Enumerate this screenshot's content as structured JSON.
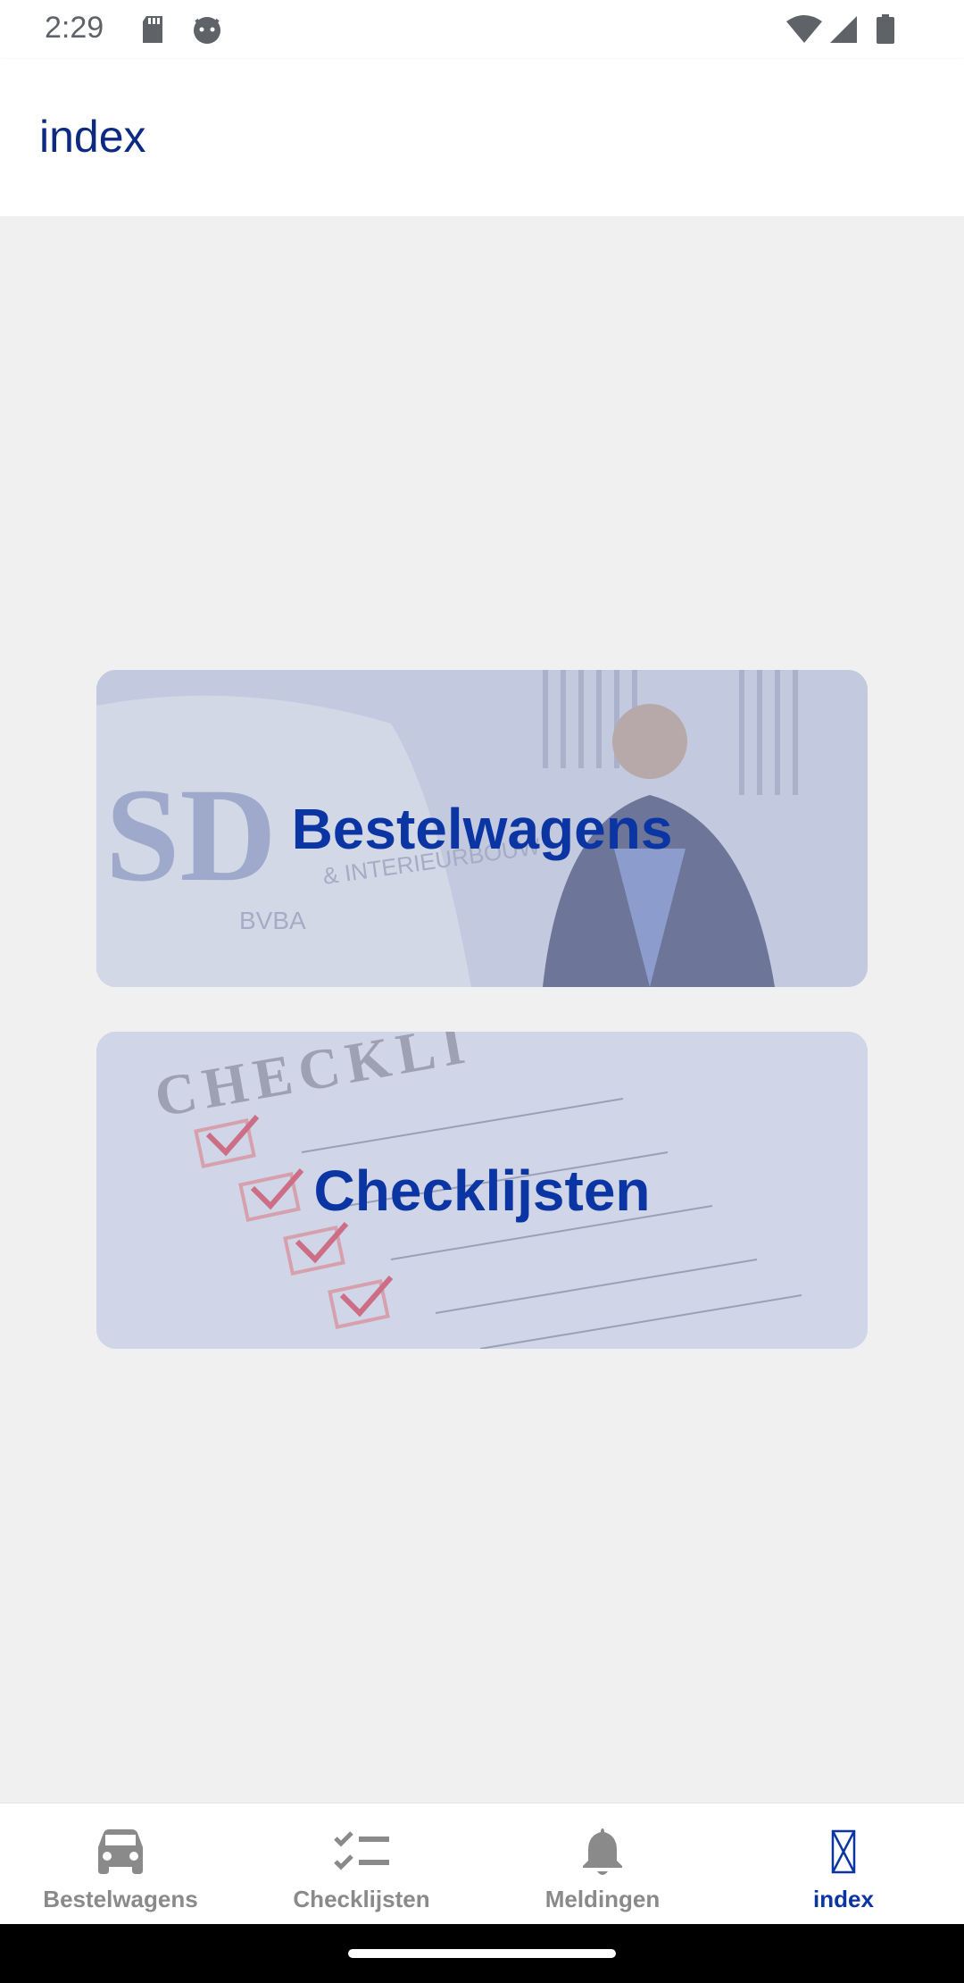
{
  "status_bar": {
    "time": "2:29",
    "icons": [
      "sd-card-icon",
      "cat-face-icon",
      "wifi-icon",
      "cell-signal-icon",
      "battery-icon"
    ]
  },
  "app_bar": {
    "title": "index"
  },
  "cards": {
    "bestelwagens": {
      "label": "Bestelwagens"
    },
    "checklijsten": {
      "label": "Checklijsten"
    }
  },
  "bottom_nav": {
    "items": [
      {
        "label": "Bestelwagens",
        "icon": "car-icon",
        "active": false
      },
      {
        "label": "Checklijsten",
        "icon": "checklist-icon",
        "active": false
      },
      {
        "label": "Meldingen",
        "icon": "bell-icon",
        "active": false
      },
      {
        "label": "index",
        "icon": "index-icon",
        "active": true
      }
    ]
  },
  "colors": {
    "accent": "#0a35a3",
    "title": "#0d2a82",
    "inactive": "#8a8a8a",
    "background": "#f0f0f0"
  }
}
